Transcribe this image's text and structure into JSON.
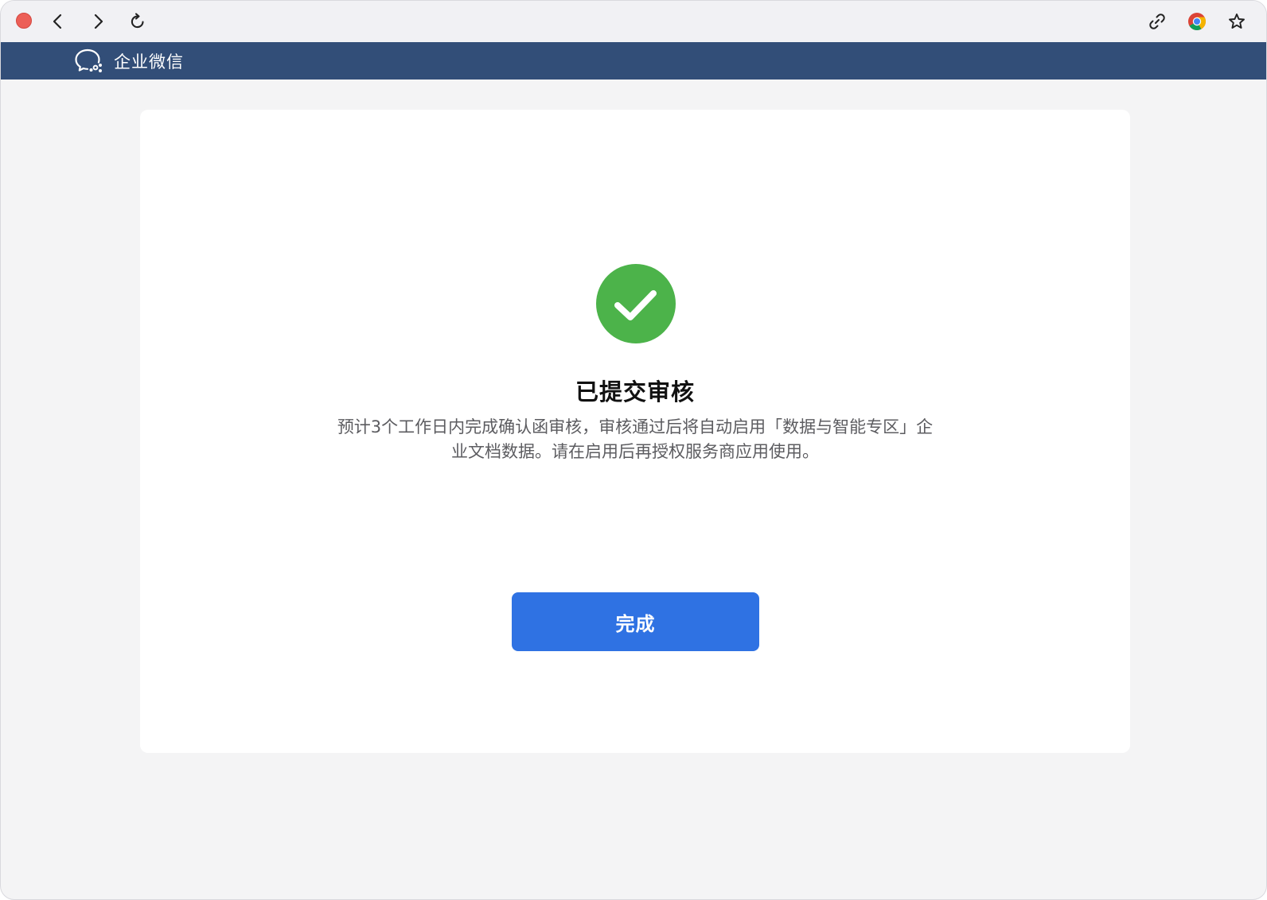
{
  "browser": {
    "icons": {
      "close": "close-dot",
      "back": "chevron-left-icon",
      "forward": "chevron-right-icon",
      "reload": "reload-icon",
      "link": "link-icon",
      "chrome": "chrome-icon",
      "bookmark": "star-icon"
    }
  },
  "app": {
    "name": "企业微信",
    "brand_color": "#324e78"
  },
  "result": {
    "title": "已提交审核",
    "description_line1": "预计3个工作日内完成确认函审核，审核通过后将自动启用「数据与智能专区」企",
    "description_line2": "业文档数据。请在启用后再授权服务商应用使用。",
    "status_color": "#4cb34a"
  },
  "actions": {
    "done_label": "完成",
    "done_color": "#2f72e3"
  }
}
